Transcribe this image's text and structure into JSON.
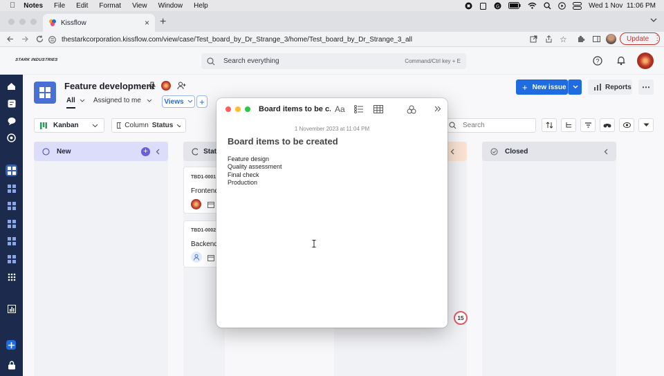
{
  "menubar": {
    "app": "Notes",
    "items": [
      "File",
      "Edit",
      "Format",
      "View",
      "Window",
      "Help"
    ],
    "clock": "Wed 1 Nov  11:06 PM"
  },
  "browser": {
    "tab_title": "Kissflow",
    "url": "thestarkcorporation.kissflow.com/view/case/Test_board_by_Dr_Strange_3/home/Test_board_by_Dr_Strange_3_all",
    "update_label": "Update"
  },
  "app": {
    "logo_text": "STARK INDUSTRIES",
    "search_placeholder": "Search everything",
    "search_shortcut": "Command/Ctrl key + E",
    "page_title": "Feature development",
    "new_issue_label": "New issue",
    "reports_label": "Reports",
    "filters": {
      "all": "All",
      "assigned": "Assigned to me",
      "views": "Views"
    },
    "view_select": "Kanban",
    "column_label": "Column",
    "column_value": "Status",
    "board_search_placeholder": "Search",
    "columns": {
      "new": "New",
      "status_partial": "Stat",
      "closed": "Closed"
    },
    "cards": [
      {
        "id": "TBD1-0001",
        "title": "Frontend"
      },
      {
        "id": "TBD1-0002",
        "title": "Backend"
      }
    ],
    "notification_badge": "15"
  },
  "notes": {
    "title": "Board items to be c...",
    "font_button": "Aa",
    "timestamp": "1 November 2023 at 11:04 PM",
    "heading": "Board items to be created",
    "lines": [
      "Feature design",
      "Quality assessment",
      "Final check",
      "Production"
    ]
  },
  "colors": {
    "accent": "#1f6ce0",
    "nav_bg": "#1c2b4d",
    "new_column": "#dcdcfb",
    "closed_column": "#e3e5ea",
    "update_red": "#c9302c"
  }
}
